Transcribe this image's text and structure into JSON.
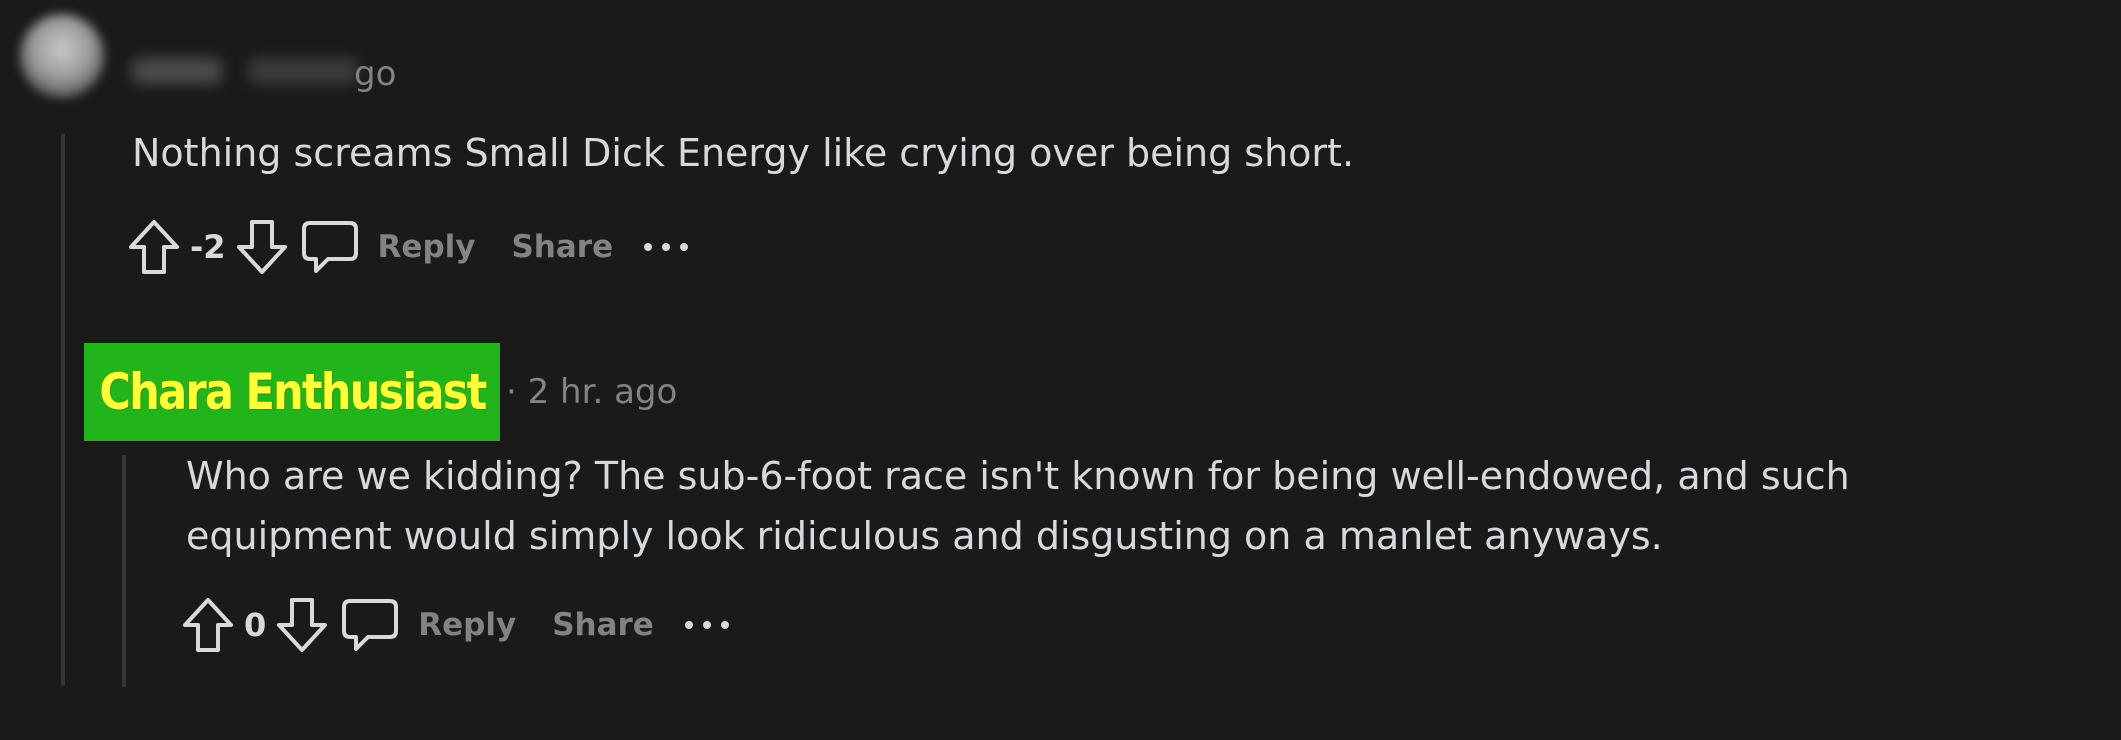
{
  "comments": [
    {
      "author": "",
      "time_suffix": "go",
      "body": "Nothing screams Small Dick Energy like crying over being short.",
      "score": "-2",
      "reply_label": "Reply",
      "share_label": "Share",
      "more_label": "···"
    },
    {
      "author_flair": "Chara Enthusiast",
      "time": "· 2 hr. ago",
      "body_lines": [
        "Who are we kidding? The sub-6-foot race isn't known for being well-endowed, and such",
        "equipment would simply look ridiculous and disgusting on a manlet anyways."
      ],
      "score": "0",
      "reply_label": "Reply",
      "share_label": "Share",
      "more_label": "···"
    }
  ],
  "colors": {
    "background": "#1a1a1b",
    "text": "#d7dadc",
    "muted": "#818384",
    "thread_line": "#343536",
    "flair_bg": "#22b41b",
    "flair_text": "#ffff3a"
  },
  "icons": [
    "upvote-icon",
    "downvote-icon",
    "comment-icon",
    "more-icon"
  ]
}
